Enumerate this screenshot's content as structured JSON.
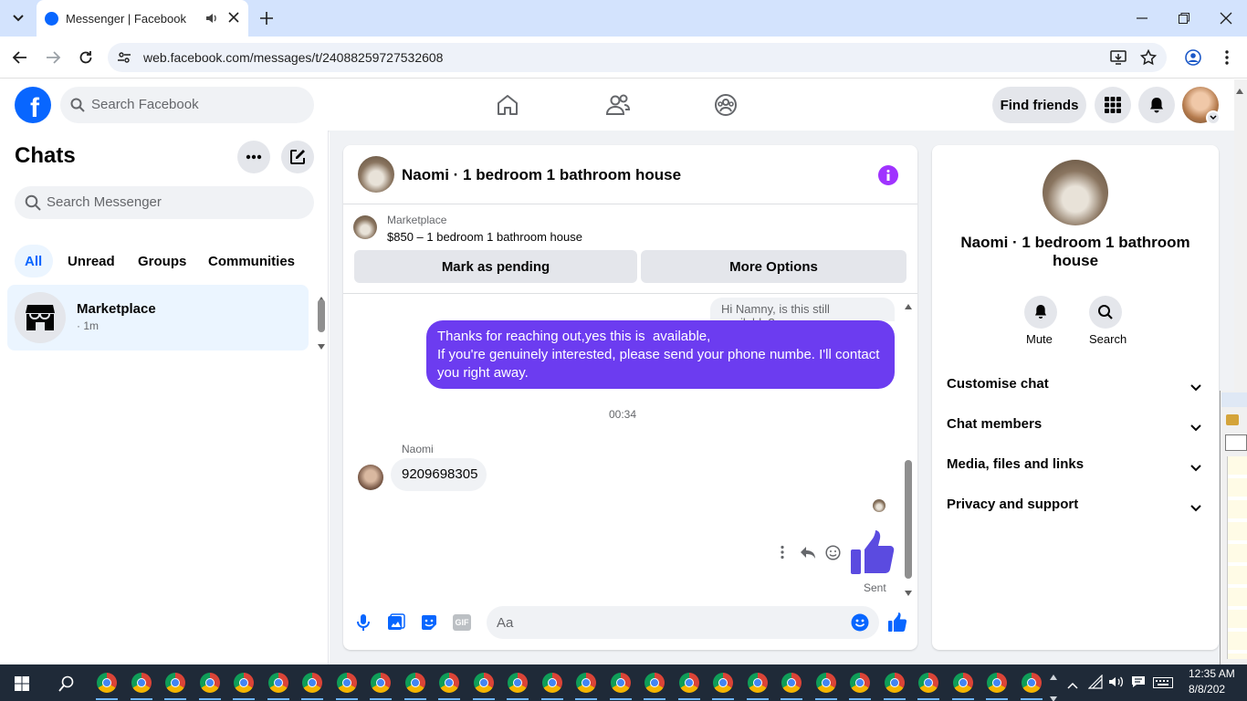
{
  "browser": {
    "tab_title": "Messenger | Facebook",
    "url": "web.facebook.com/messages/t/24088259727532608"
  },
  "facebook": {
    "search_placeholder": "Search Facebook",
    "find_friends": "Find friends"
  },
  "sidebar": {
    "title": "Chats",
    "search_placeholder": "Search Messenger",
    "filters": [
      "All",
      "Unread",
      "Groups",
      "Communities"
    ],
    "active_filter": "All",
    "chats": [
      {
        "name": "Marketplace",
        "sub": "· 1m"
      }
    ]
  },
  "chat": {
    "title": "Naomi · 1 bedroom 1 bathroom house",
    "listing_source": "Marketplace",
    "listing_title": "$850 – 1 bedroom 1 bathroom house",
    "mark_pending": "Mark as pending",
    "more_options": "More Options",
    "messages": {
      "quoted": "Hi Namny, is this still available?",
      "outgoing": "Thanks for reaching out,yes this is  available,\nIf you're genuinely interested, please send your phone numbe. I'll contact you right away.",
      "timestamp": "00:34",
      "sender_name": "Naomi",
      "incoming": "9209698305",
      "status": "Sent"
    },
    "composer_placeholder": "Aa"
  },
  "info": {
    "name": "Naomi · 1 bedroom 1 bathroom house",
    "actions": [
      "Mute",
      "Search"
    ],
    "sections": [
      "Customise chat",
      "Chat members",
      "Media, files and links",
      "Privacy and support"
    ]
  },
  "taskbar": {
    "time": "12:35 AM",
    "date": "8/8/202"
  },
  "colors": {
    "fb_blue": "#0866ff",
    "messenger_purple": "#6c3cf0",
    "taskbar": "#1f2a38"
  }
}
